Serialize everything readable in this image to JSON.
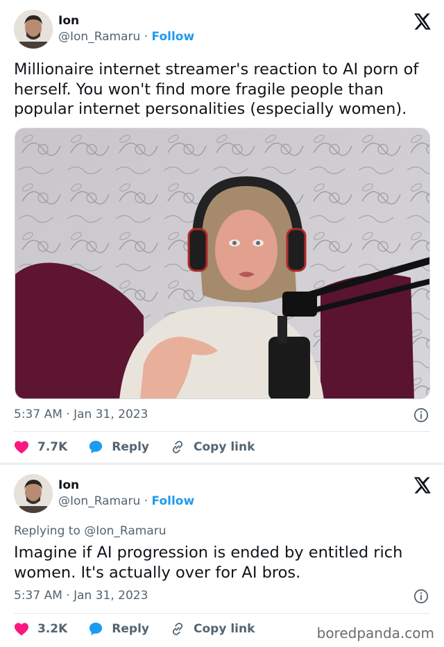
{
  "tweets": [
    {
      "author": {
        "name": "Ion",
        "handle": "@Ion_Ramaru",
        "separator": "·",
        "follow_label": "Follow"
      },
      "text": "Millionaire internet streamer's reaction to AI porn of herself. You won't find more fragile people than popular internet personalities (especially women).",
      "timestamp": "5:37 AM · Jan 31, 2023",
      "actions": {
        "likes": "7.7K",
        "reply_label": "Reply",
        "copy_label": "Copy link"
      }
    },
    {
      "author": {
        "name": "Ion",
        "handle": "@Ion_Ramaru",
        "separator": "·",
        "follow_label": "Follow"
      },
      "replying_to": "Replying to @Ion_Ramaru",
      "text": "Imagine if AI progression is ended by entitled rich women. It's actually over for AI bros.",
      "timestamp": "5:37 AM · Jan 31, 2023",
      "actions": {
        "likes": "3.2K",
        "reply_label": "Reply",
        "copy_label": "Copy link"
      }
    }
  ],
  "watermark": "boredpanda.com",
  "colors": {
    "accent": "#1d9bf0",
    "like": "#f91880",
    "text": "#0f1419",
    "muted": "#536471"
  },
  "icons": [
    "x-logo-icon",
    "info-icon",
    "heart-icon",
    "reply-bubble-icon",
    "link-icon"
  ]
}
